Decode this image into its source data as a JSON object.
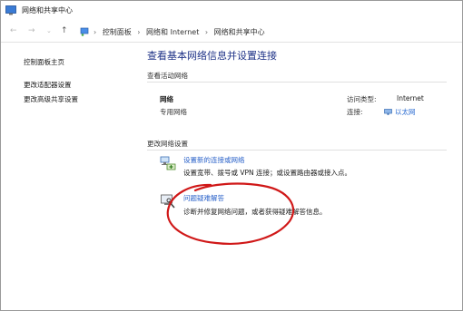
{
  "window": {
    "title": "网络和共享中心"
  },
  "nav": {
    "back": "←",
    "forward": "→",
    "dropdown": "⌄",
    "up": "↑",
    "breadcrumbs": [
      "控制面板",
      "网络和 Internet",
      "网络和共享中心"
    ],
    "separator": "›"
  },
  "sidebar": {
    "items": [
      {
        "label": "控制面板主页"
      },
      {
        "label": "更改适配器设置"
      },
      {
        "label": "更改高级共享设置"
      }
    ]
  },
  "main": {
    "heading": "查看基本网络信息并设置连接",
    "active_networks_title": "查看活动网络",
    "network": {
      "name": "网络",
      "profile": "专用网络",
      "access_type_label": "访问类型:",
      "access_type_value": "Internet",
      "connections_label": "连接:",
      "connections_value": "以太网"
    },
    "change_settings_title": "更改网络设置",
    "tasks": [
      {
        "link": "设置新的连接或网络",
        "description": "设置宽带、拨号或 VPN 连接；或设置路由器或接入点。",
        "icon": "new-connection-icon"
      },
      {
        "link": "问题疑难解答",
        "description": "诊断并修复网络问题，或者获得疑难解答信息。",
        "icon": "troubleshoot-icon"
      }
    ]
  },
  "annotation": {
    "color": "#d01818"
  }
}
